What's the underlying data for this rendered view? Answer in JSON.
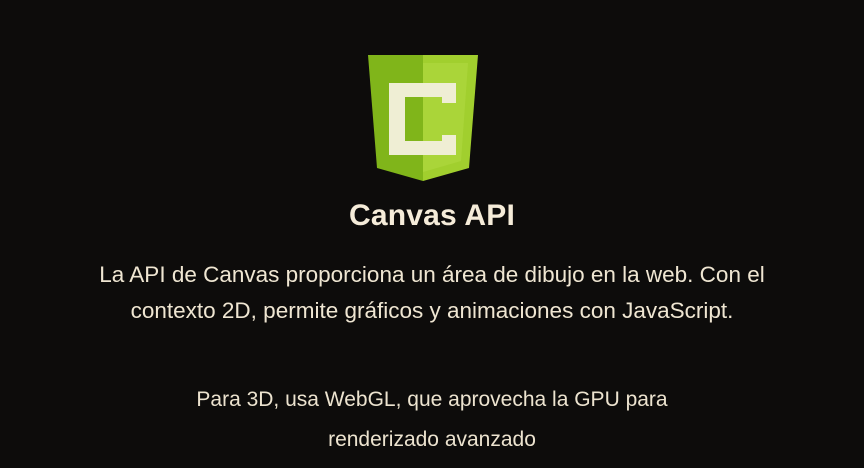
{
  "logo": {
    "icon": "canvas-c-shield-logo",
    "letter": "C",
    "colors": {
      "shield_left": "#83b81c",
      "shield_right": "#9ccc2a",
      "letter": "#efeed4"
    }
  },
  "title": "Canvas API",
  "description": {
    "line1": "La API de Canvas proporciona un área de dibujo en la web. Con el",
    "line2": "contexto 2D, permite gráficos y animaciones con JavaScript."
  },
  "note": {
    "line1": "Para 3D, usa WebGL, que aprovecha la GPU para",
    "line2": "renderizado avanzado"
  },
  "colors": {
    "background": "#0d0c0b",
    "text": "#f3ead8"
  }
}
